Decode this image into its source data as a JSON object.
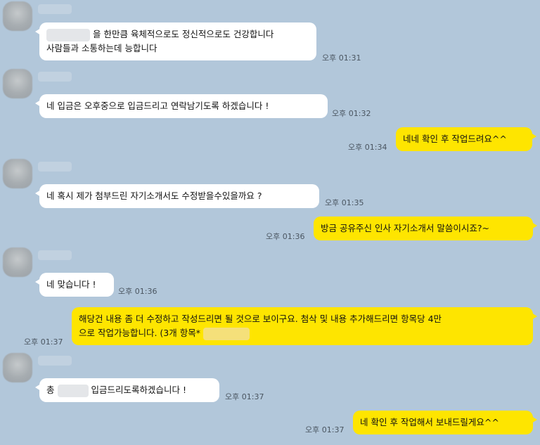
{
  "messages": [
    {
      "line1": "을 한만큼 육체적으로도 정신적으로도 건강합니다",
      "line2": "사람들과 소통하는데 능합니다",
      "time": "오후 01:31"
    },
    {
      "text": "네 입금은 오후중으로 입금드리고 연락남기도록 하겠습니다 !",
      "time": "오후 01:32"
    },
    {
      "text": "네네 확인 후 작업드려요^^",
      "time": "오후 01:34"
    },
    {
      "text": "네 혹시 제가 첨부드린 자기소개서도 수정받을수있을까요 ?",
      "time": "오후 01:35"
    },
    {
      "text": "방금 공유주신 인사 자기소개서 말씀이시죠?~",
      "time": "오후 01:36"
    },
    {
      "text": "네 맞습니다 !",
      "time": "오후 01:36"
    },
    {
      "line1": "해당건 내용 좀 더 수정하고 작성드리면 될 것으로 보이구요. 첨삭 및 내용 추가해드리면 항목당 4만",
      "line2": "으로 작업가능합니다. (3개 항목*",
      "time": "오후 01:37"
    },
    {
      "prefix": "총",
      "suffix": "입금드리도록하겠습니다 !",
      "time": "오후 01:37"
    },
    {
      "text": "네 확인 후 작업해서 보내드릴게요^^",
      "time": "오후 01:37"
    }
  ]
}
